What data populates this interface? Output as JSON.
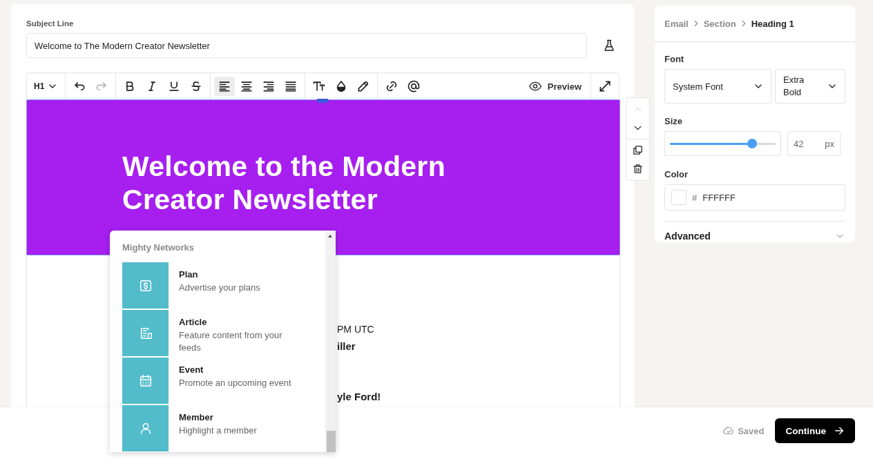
{
  "subject": {
    "label": "Subject Line",
    "value": "Welcome to The Modern Creator Newsletter"
  },
  "toolbar": {
    "block_type": "H1",
    "buttons": [
      {
        "kind": "undo",
        "selected": false,
        "disabled": false
      },
      {
        "kind": "redo",
        "selected": false,
        "disabled": true
      },
      {
        "kind": "bold",
        "selected": false,
        "disabled": false
      },
      {
        "kind": "italic",
        "selected": false,
        "disabled": false
      },
      {
        "kind": "underline",
        "selected": false,
        "disabled": false
      },
      {
        "kind": "strikethrough",
        "selected": false,
        "disabled": false
      },
      {
        "kind": "align-left",
        "selected": true,
        "disabled": false
      },
      {
        "kind": "align-center",
        "selected": false,
        "disabled": false
      },
      {
        "kind": "align-right",
        "selected": false,
        "disabled": false
      },
      {
        "kind": "justify",
        "selected": false,
        "disabled": false
      },
      {
        "kind": "text-size",
        "selected": false,
        "disabled": false
      },
      {
        "kind": "fill",
        "selected": false,
        "disabled": false
      },
      {
        "kind": "highlight",
        "selected": false,
        "disabled": false
      },
      {
        "kind": "link",
        "selected": false,
        "disabled": false
      },
      {
        "kind": "mention",
        "selected": false,
        "disabled": false
      }
    ],
    "preview": "Preview"
  },
  "heading_block": {
    "text": "Welcome to the Modern Creator Newsletter"
  },
  "content_fragments": [
    {
      "text": "PM UTC",
      "bold": false
    },
    {
      "text": "iller",
      "bold": true
    },
    {
      "text": "yle Ford!",
      "bold": true
    }
  ],
  "block_actions": [
    {
      "kind": "move-up",
      "disabled": true
    },
    {
      "kind": "move-down",
      "disabled": false
    },
    {
      "kind": "duplicate",
      "disabled": false
    },
    {
      "kind": "delete",
      "disabled": false
    }
  ],
  "insert_menu": {
    "title": "Mighty Networks",
    "items": [
      {
        "kind": "plan",
        "title": "Plan",
        "description": "Advertise your plans"
      },
      {
        "kind": "article",
        "title": "Article",
        "description": "Feature content from your feeds"
      },
      {
        "kind": "event",
        "title": "Event",
        "description": "Promote an upcoming event"
      },
      {
        "kind": "member",
        "title": "Member",
        "description": "Highlight a member"
      }
    ]
  },
  "panel": {
    "breadcrumb": [
      {
        "label": "Email",
        "current": false
      },
      {
        "label": "Section",
        "current": false
      },
      {
        "label": "Heading 1",
        "current": true
      }
    ],
    "font_label": "Font",
    "font_family": "System Font",
    "font_weight": "Extra Bold",
    "size_label": "Size",
    "size": {
      "level": 0.78,
      "value": "42",
      "unit": "px"
    },
    "color_label": "Color",
    "color": {
      "hash": "#",
      "value": "FFFFFF"
    },
    "advanced": {
      "label": "Advanced",
      "expanded": false
    }
  },
  "footer": {
    "status": "Saved",
    "continue": "Continue"
  }
}
